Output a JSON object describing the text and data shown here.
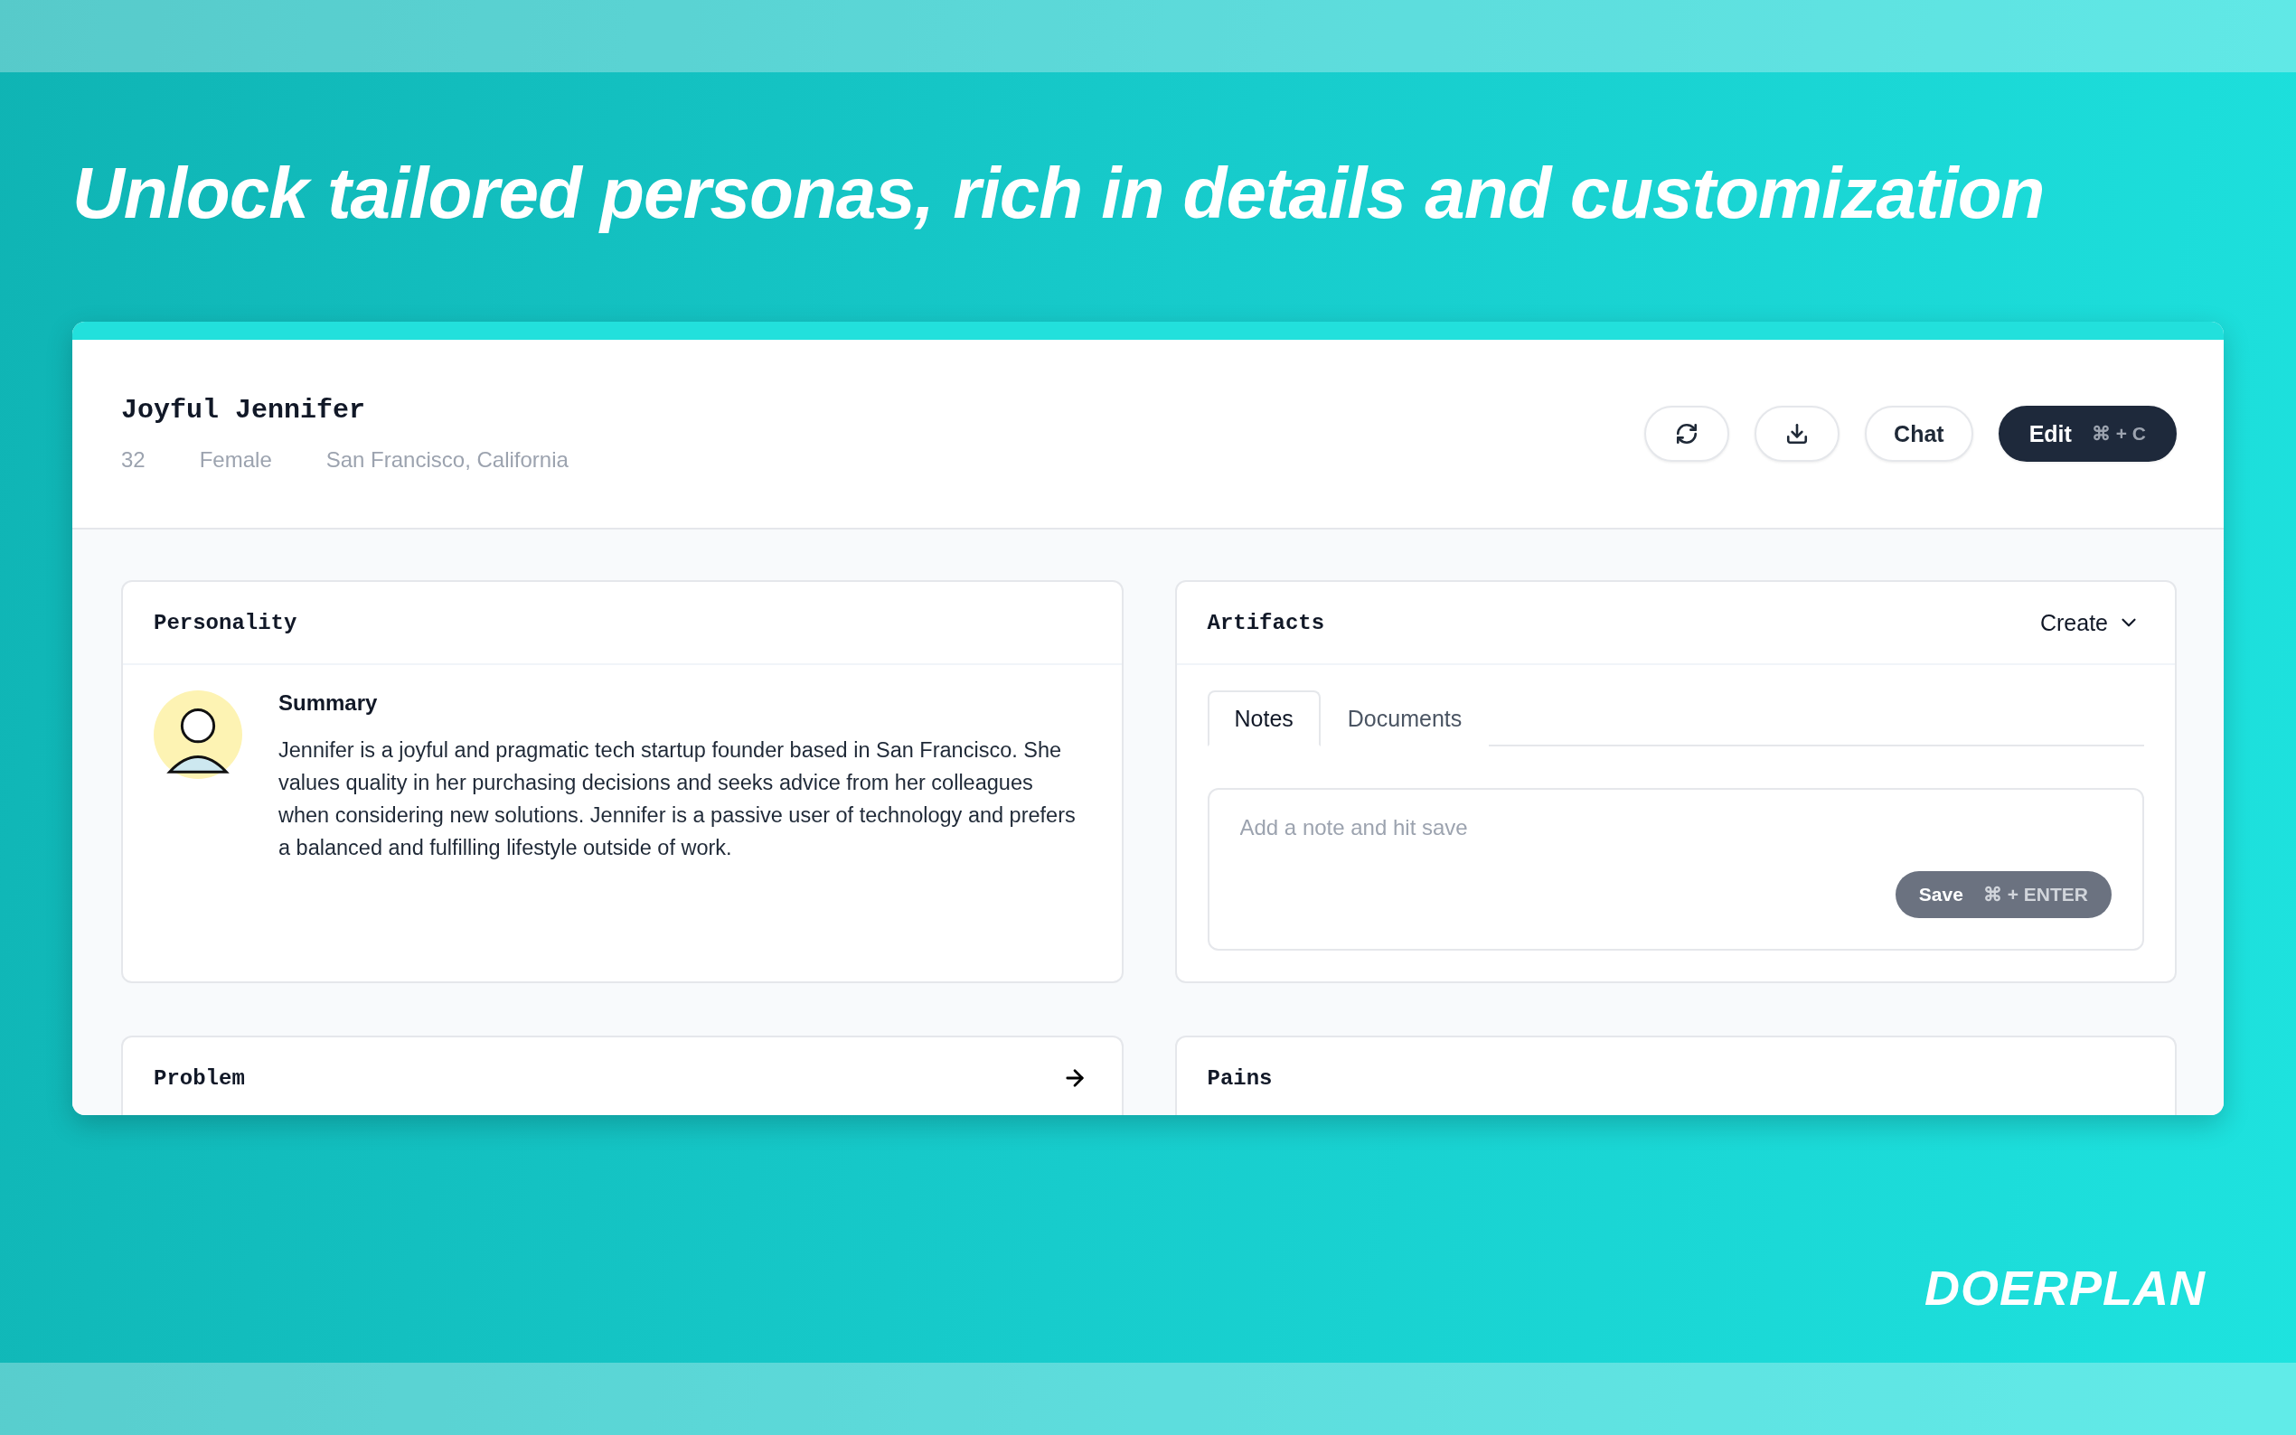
{
  "headline": "Unlock tailored personas, rich in details and customization",
  "persona": {
    "name": "Joyful Jennifer",
    "meta": [
      "32",
      "Female",
      "San Francisco, California"
    ]
  },
  "actions": [
    {
      "kind": "refresh"
    },
    {
      "kind": "download"
    },
    {
      "kind": "text",
      "label": "Chat"
    },
    {
      "kind": "primary",
      "label": "Edit",
      "shortcut": "⌘ + C"
    }
  ],
  "personality": {
    "title": "Personality",
    "summary_title": "Summary",
    "summary": "Jennifer is a joyful and pragmatic tech startup founder based in San Francisco. She values quality in her purchasing decisions and seeks advice from her colleagues when considering new solutions. Jennifer is a passive user of technology and prefers a balanced and fulfilling lifestyle outside of work."
  },
  "artifacts": {
    "title": "Artifacts",
    "create": "Create",
    "tabs": [
      {
        "label": "Notes",
        "selected": true
      },
      {
        "label": "Documents",
        "selected": false
      }
    ],
    "note": {
      "placeholder": "Add a note and hit save"
    },
    "save": {
      "label": "Save",
      "shortcut": "⌘ + ENTER"
    }
  },
  "lower_cards": [
    {
      "title": "Problem",
      "arrow": true
    },
    {
      "title": "Pains",
      "arrow": false
    }
  ],
  "brand": "DOERPLAN"
}
